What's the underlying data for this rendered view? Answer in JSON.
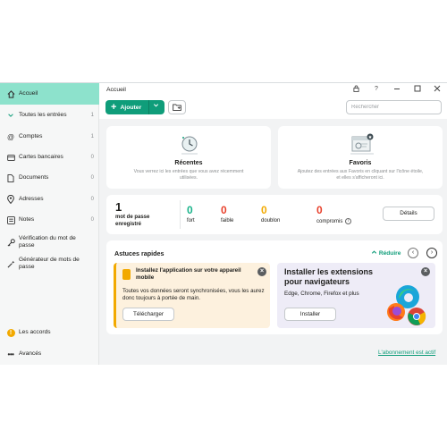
{
  "sidebar": {
    "items": [
      {
        "label": "Accueil",
        "count": ""
      },
      {
        "label": "Toutes les entrées",
        "count": "1"
      },
      {
        "label": "Comptes",
        "count": "1"
      },
      {
        "label": "Cartes bancaires",
        "count": "0"
      },
      {
        "label": "Documents",
        "count": "0"
      },
      {
        "label": "Adresses",
        "count": "0"
      },
      {
        "label": "Notes",
        "count": "0"
      },
      {
        "label": "Vérification du mot de passe",
        "count": ""
      },
      {
        "label": "Générateur de mots de passe",
        "count": ""
      },
      {
        "label": "Les accords",
        "count": ""
      },
      {
        "label": "Avancés",
        "count": ""
      }
    ]
  },
  "header": {
    "title": "Accueil"
  },
  "toolbar": {
    "add_label": "Ajouter",
    "search_placeholder": "Rechercher"
  },
  "recent": {
    "title": "Récentes",
    "desc": "Vous verrez ici les entrées que vous avez récemment utilisées."
  },
  "favorites": {
    "title": "Favoris",
    "desc": "Ajoutez des entrées aux Favoris en cliquant sur l'icône étoile, et elles s'afficheront ici."
  },
  "stats": {
    "total_value": "1",
    "total_label": "mot de passe enregistré",
    "strong_value": "0",
    "strong_label": "fort",
    "weak_value": "0",
    "weak_label": "faible",
    "duplicate_value": "0",
    "duplicate_label": "doublon",
    "compromised_value": "0",
    "compromised_label": "compromis",
    "details_label": "Détails"
  },
  "tips": {
    "title": "Astuces rapides",
    "reduce_label": "Réduire",
    "mobile": {
      "title": "Installez l'application sur votre appareil mobile",
      "desc": "Toutes vos données seront synchronisées, vous les aurez donc toujours à portée de main.",
      "button": "Télécharger"
    },
    "browser": {
      "title": "Installer les extensions pour navigateurs",
      "desc": "Edge, Chrome, Firefox et plus",
      "button": "Installer"
    }
  },
  "footer": {
    "subscription_link": "L'abonnement est actif"
  },
  "colors": {
    "accent": "#0f9d7a",
    "active_nav": "#8de2cc",
    "strong": "#19b38a",
    "weak": "#e8412c",
    "duplicate": "#f2a900",
    "compromised": "#e8412c"
  }
}
